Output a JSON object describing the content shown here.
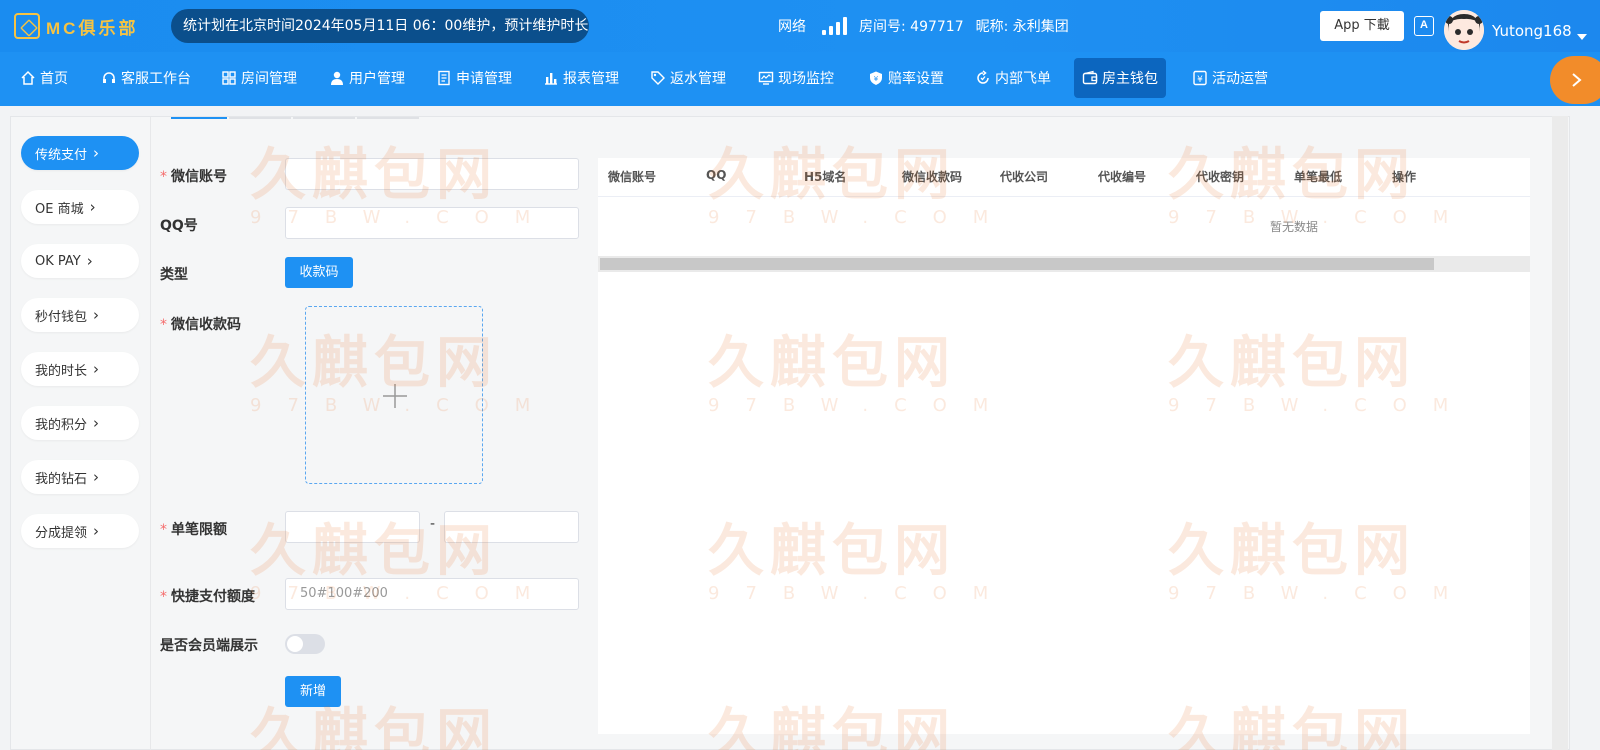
{
  "header": {
    "logo_text": "MC俱乐部",
    "notice": "统计划在北京时间2024年05月11日 06：00维护，预计维护时长!",
    "network_label": "网络",
    "room_label": "房间号: 497717",
    "nickname_label": "昵称: 永利集团",
    "app_download": "App 下載",
    "lang_icon": "A",
    "username": "Yutong168"
  },
  "nav": {
    "items": [
      {
        "label": "首页",
        "icon": "home-icon"
      },
      {
        "label": "客服工作台",
        "icon": "headset-icon"
      },
      {
        "label": "房间管理",
        "icon": "grid-icon"
      },
      {
        "label": "用户管理",
        "icon": "user-icon"
      },
      {
        "label": "申请管理",
        "icon": "document-icon"
      },
      {
        "label": "报表管理",
        "icon": "bar-chart-icon"
      },
      {
        "label": "返水管理",
        "icon": "tag-icon"
      },
      {
        "label": "现场监控",
        "icon": "monitor-icon"
      },
      {
        "label": "赔率设置",
        "icon": "shield-icon"
      },
      {
        "label": "内部飞单",
        "icon": "refresh-icon"
      },
      {
        "label": "房主钱包",
        "icon": "wallet-icon"
      },
      {
        "label": "活动运营",
        "icon": "yen-icon"
      }
    ],
    "active_index": 10
  },
  "sidebar": {
    "items": [
      {
        "label": "传统支付"
      },
      {
        "label": "OE 商城"
      },
      {
        "label": "OK PAY"
      },
      {
        "label": "秒付钱包"
      },
      {
        "label": "我的时长"
      },
      {
        "label": "我的积分"
      },
      {
        "label": "我的钻石"
      },
      {
        "label": "分成提领"
      }
    ],
    "active_index": 0
  },
  "form": {
    "wechat_account_label": "微信账号",
    "qq_label": "QQ号",
    "type_label": "类型",
    "type_button": "收款码",
    "wechat_qr_label": "微信收款码",
    "limit_label": "单笔限额",
    "limit_separator": "-",
    "quick_amount_label": "快捷支付额度",
    "quick_amount_placeholder": "50#100#200",
    "member_display_label": "是否会员端展示",
    "member_display_on": false,
    "submit_button": "新增"
  },
  "table": {
    "columns": [
      "微信账号",
      "QQ",
      "H5域名",
      "微信收款码",
      "代收公司",
      "代收编号",
      "代收密钥",
      "单笔最低",
      "操作"
    ],
    "empty_text": "暂无数据"
  },
  "watermark": {
    "cn": "久麒包网",
    "en": "97BW.COM"
  },
  "colors": {
    "primary": "#1e91f3",
    "active_nav": "#0c66bf",
    "notice_bg": "#0b4f8c",
    "logo_gold": "#f6c343",
    "required": "#f56c6c",
    "nav_arrow": "#f28c2a"
  }
}
